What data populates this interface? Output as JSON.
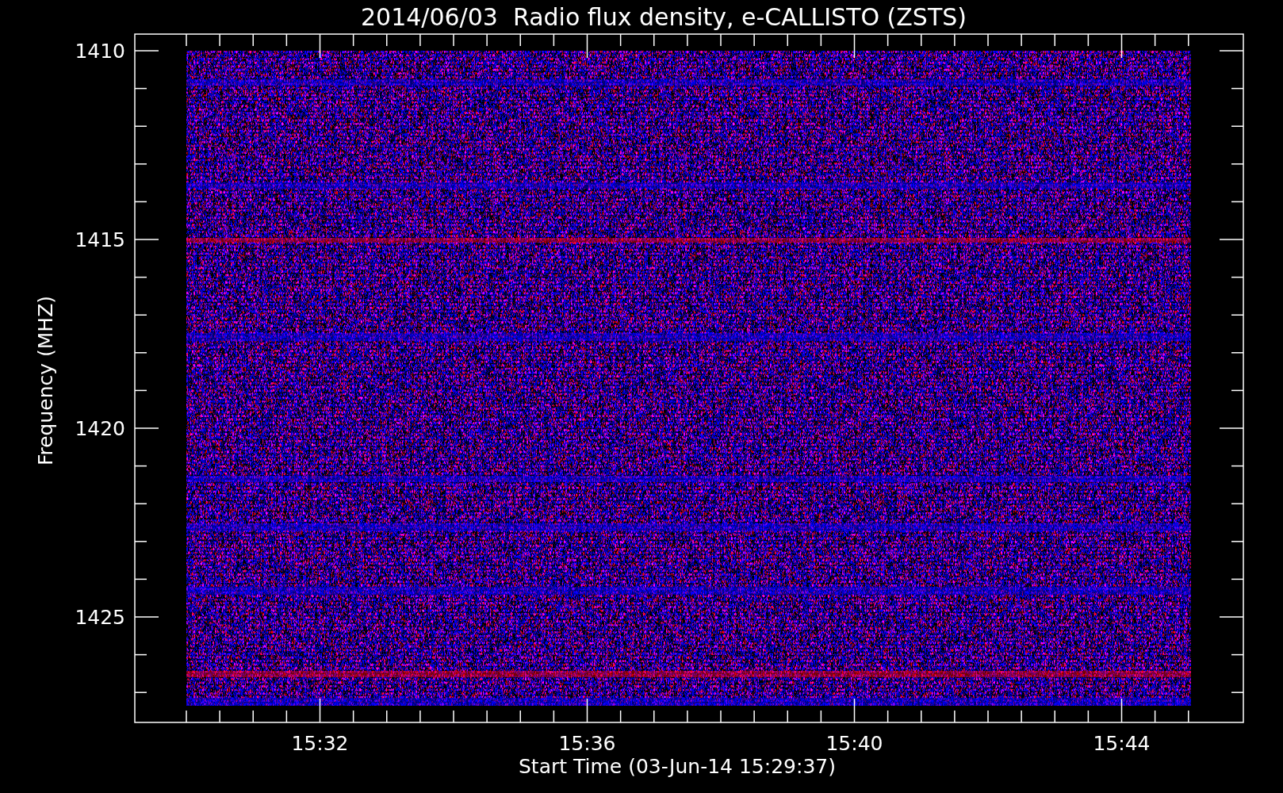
{
  "plot": {
    "title": "2014/06/03  Radio flux density, e-CALLISTO (ZSTS)",
    "x_axis": {
      "label": "Start Time (03-Jun-14 15:29:37)",
      "ticks": [
        "15:32",
        "15:36",
        "15:40",
        "15:44"
      ]
    },
    "y_axis": {
      "label": "Frequency (MHZ)",
      "ticks": [
        "1410",
        "1415",
        "1420",
        "1425"
      ]
    }
  }
}
